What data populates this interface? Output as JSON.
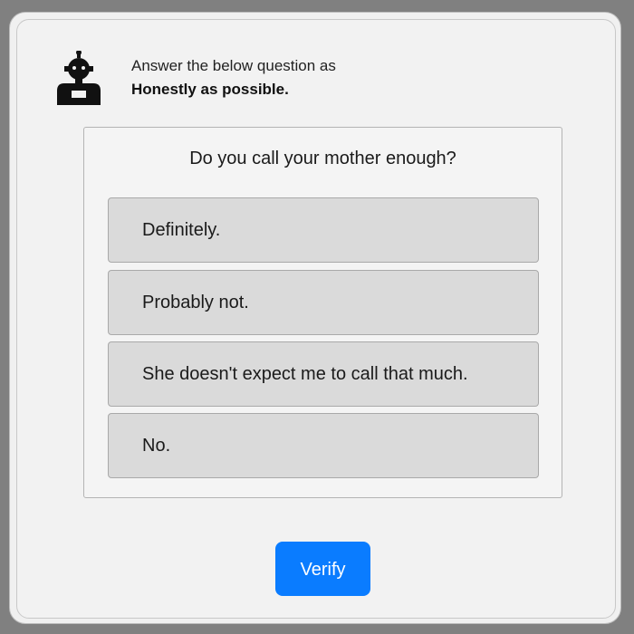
{
  "header": {
    "icon": "robot-icon",
    "line1": "Answer the below question as",
    "line2": "Honestly as possible."
  },
  "question": {
    "text": "Do you call your mother enough?",
    "options": [
      "Definitely.",
      "Probably not.",
      "She doesn't expect me to call that much.",
      "No."
    ]
  },
  "verify_button": {
    "label": "Verify",
    "color": "#0a7cff"
  }
}
